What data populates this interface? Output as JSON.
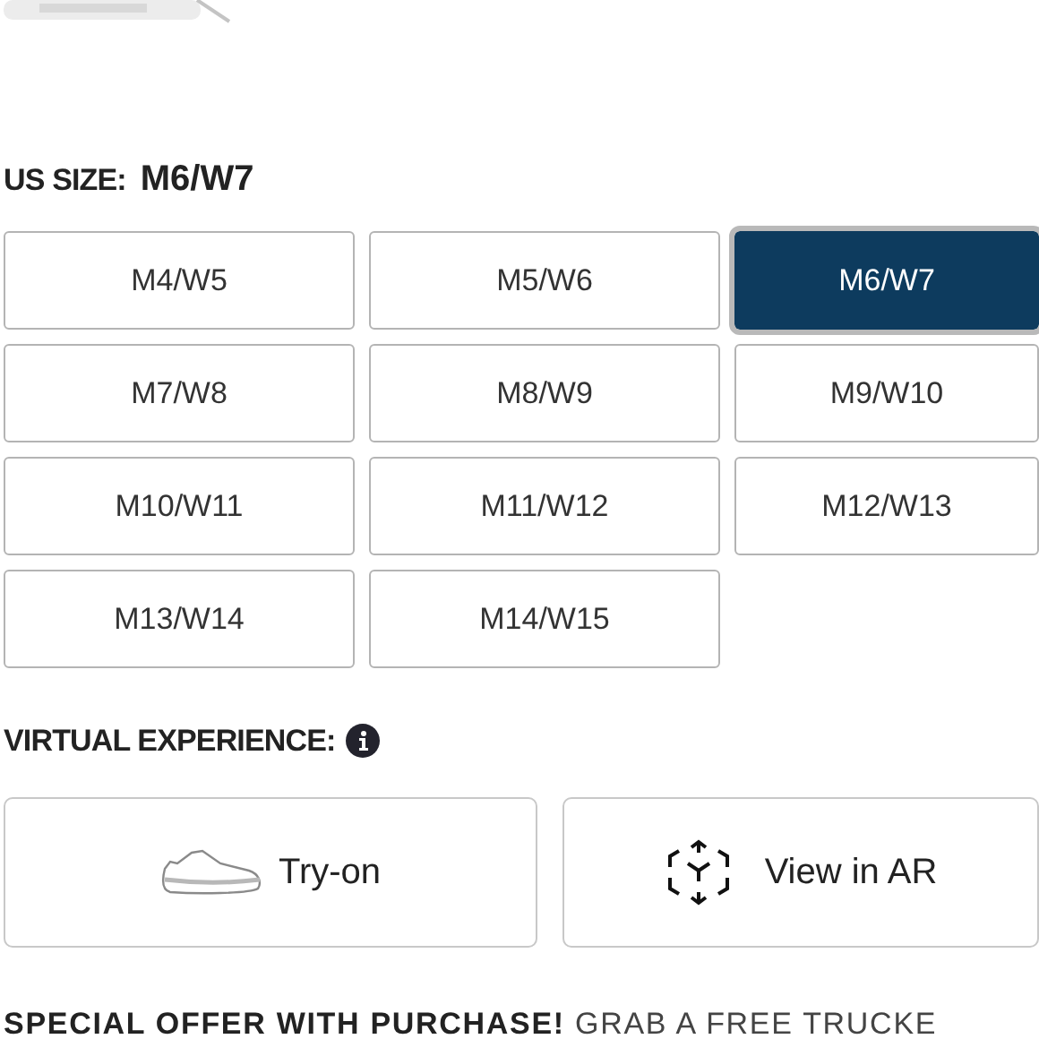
{
  "size_label": "US SIZE:",
  "selected_size": "M6/W7",
  "sizes": [
    {
      "label": "M4/W5",
      "selected": false
    },
    {
      "label": "M5/W6",
      "selected": false
    },
    {
      "label": "M6/W7",
      "selected": true
    },
    {
      "label": "M7/W8",
      "selected": false
    },
    {
      "label": "M8/W9",
      "selected": false
    },
    {
      "label": "M9/W10",
      "selected": false
    },
    {
      "label": "M10/W11",
      "selected": false
    },
    {
      "label": "M11/W12",
      "selected": false
    },
    {
      "label": "M12/W13",
      "selected": false
    },
    {
      "label": "M13/W14",
      "selected": false
    },
    {
      "label": "M14/W15",
      "selected": false
    }
  ],
  "virtual_label": "VIRTUAL EXPERIENCE:",
  "virtual_options": [
    {
      "kind": "try-on",
      "label": "Try-on"
    },
    {
      "kind": "ar",
      "label": "View in AR"
    }
  ],
  "offer": {
    "title": "SPECIAL OFFER WITH PURCHASE!",
    "text": "GRAB A FREE TRUCKE"
  }
}
